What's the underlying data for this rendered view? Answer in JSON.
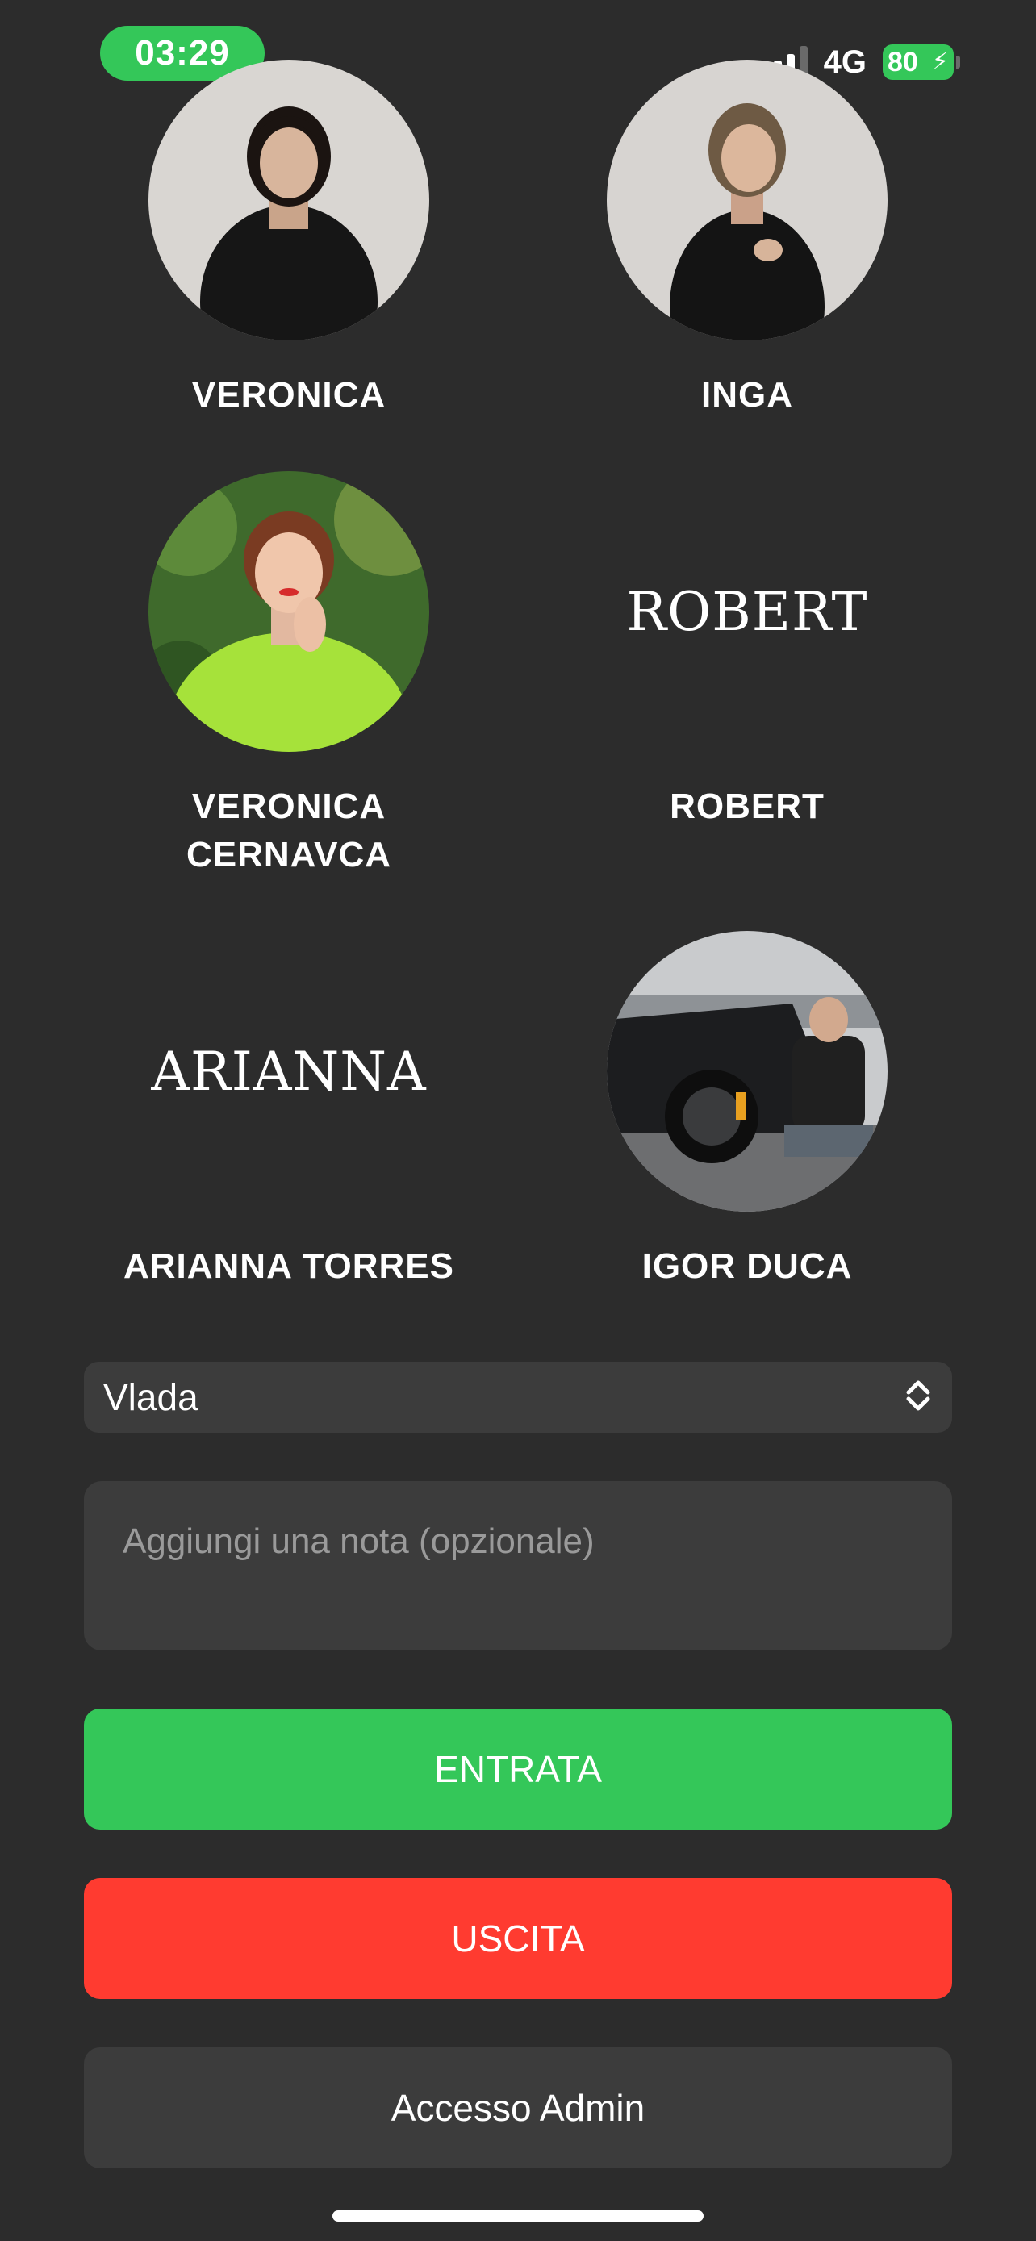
{
  "status_bar": {
    "time": "03:29",
    "network": "4G",
    "battery": "80",
    "signal_icon": "cellular-signal-icon",
    "battery_icon": "battery-charging-icon"
  },
  "profiles": [
    {
      "name": "VERONICA",
      "avatar": "photo"
    },
    {
      "name": "INGA",
      "avatar": "photo"
    },
    {
      "name": "VERONICA CERNAVCA",
      "avatar": "photo"
    },
    {
      "name": "ROBERT",
      "avatar": "text",
      "logo_text": "ROBERT"
    },
    {
      "name": "ARIANNA TORRES",
      "avatar": "text",
      "logo_text": "ARIANNA"
    },
    {
      "name": "IGOR DUCA",
      "avatar": "photo"
    }
  ],
  "form": {
    "select_value": "Vlada",
    "select_icon": "chevron-up-down-icon",
    "note_placeholder": "Aggiungi una nota (opzionale)"
  },
  "buttons": {
    "check_in": "ENTRATA",
    "check_out": "USCITA",
    "admin": "Accesso Admin"
  },
  "colors": {
    "background": "#2c2c2c",
    "accent_green": "#34c759",
    "accent_red": "#ff3b30",
    "field": "#3c3c3c"
  }
}
